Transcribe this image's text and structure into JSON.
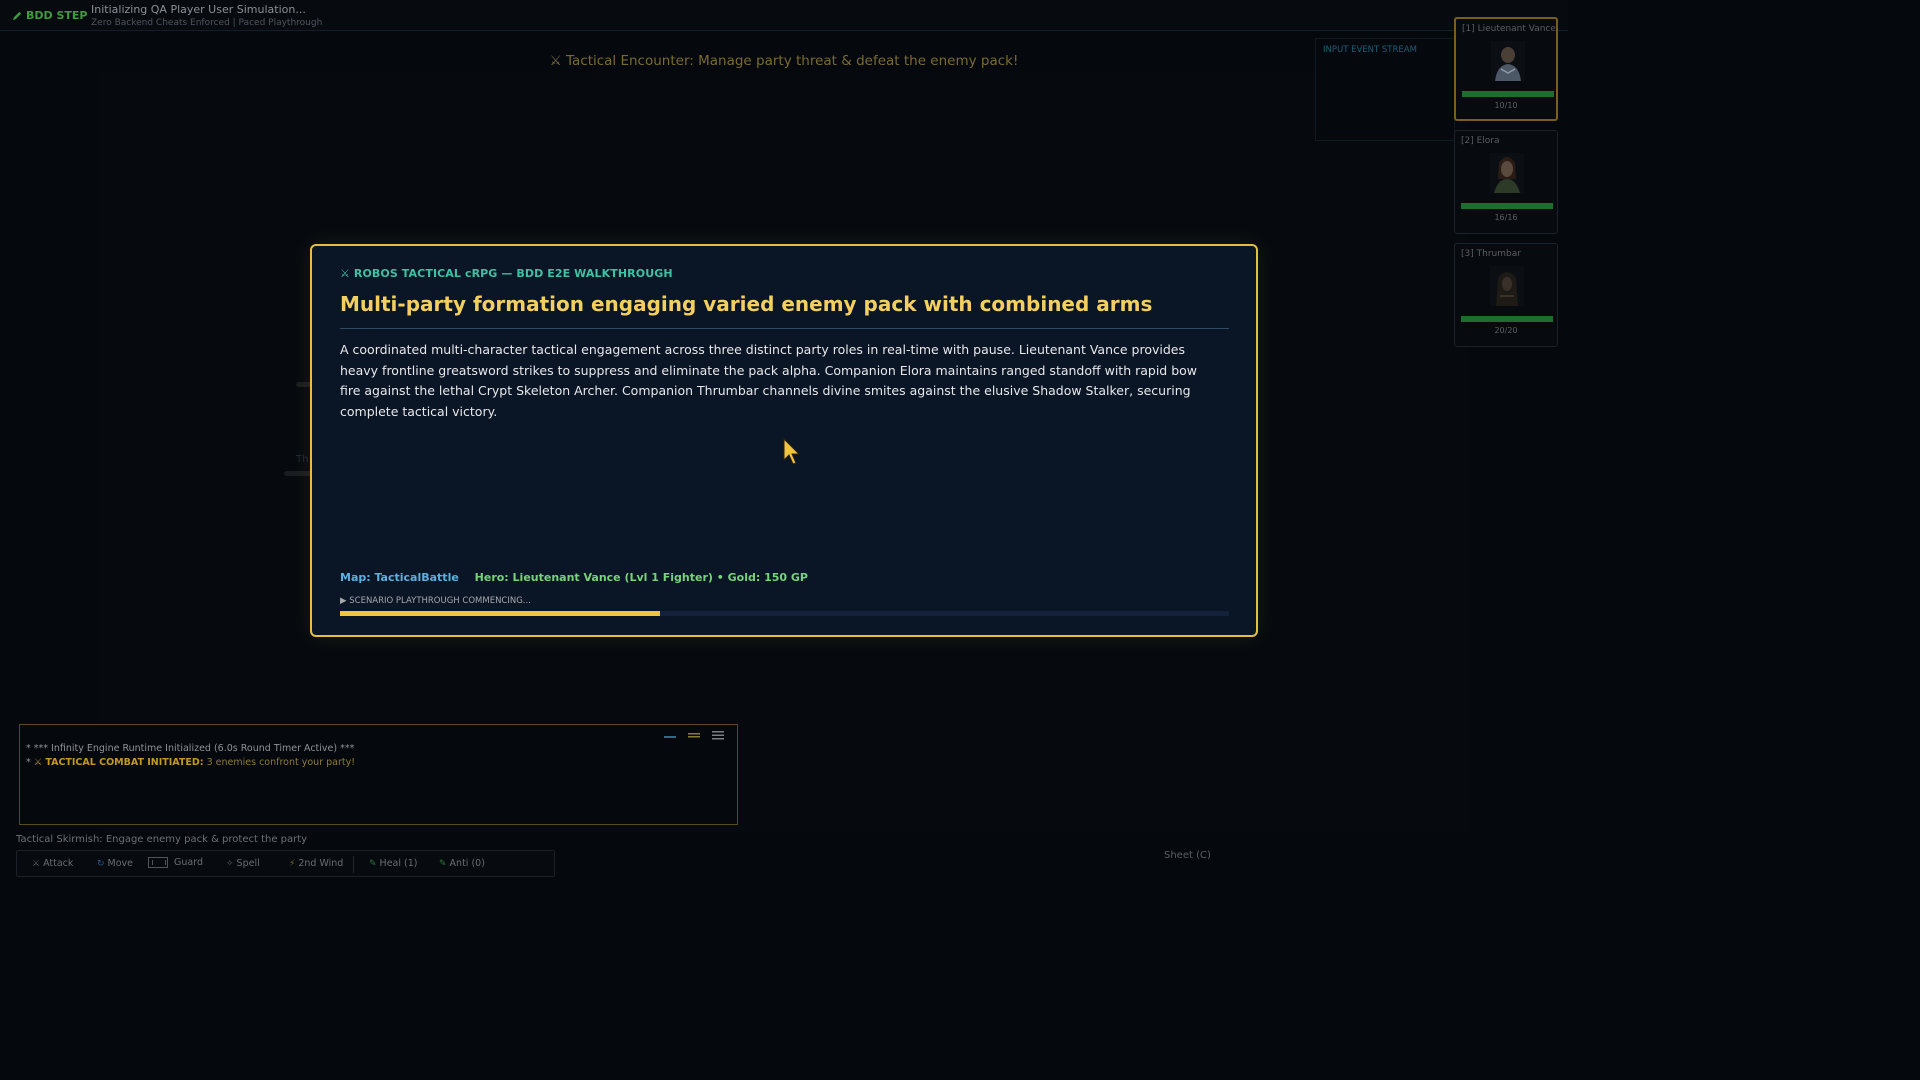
{
  "topbar": {
    "step_label": "BDD STEP",
    "title": "Initializing QA Player User Simulation...",
    "subtitle": "Zero Backend Cheats Enforced | Paced Playthrough"
  },
  "encounter": {
    "title": "⚔ Tactical Encounter: Manage party threat & defeat the enemy pack!",
    "ghost_text": "Th"
  },
  "event_stream": {
    "label": "INPUT EVENT STREAM"
  },
  "party": [
    {
      "key": "[1]",
      "name": "Lieutenant Vance",
      "hp": "10/10",
      "hp_fraction": 1.0,
      "active": true
    },
    {
      "key": "[2]",
      "name": "Elora",
      "hp": "16/16",
      "hp_fraction": 1.0,
      "active": false
    },
    {
      "key": "[3]",
      "name": "Thrumbar",
      "hp": "20/20",
      "hp_fraction": 1.0,
      "active": false
    }
  ],
  "modal": {
    "kicker": "⚔ ROBOS TACTICAL cRPG — BDD E2E WALKTHROUGH",
    "title": "Multi-party formation engaging varied enemy pack with combined arms",
    "description": "A coordinated multi-character tactical engagement across three distinct party roles in real-time with pause. Lieutenant Vance provides heavy frontline greatsword strikes to suppress and eliminate the pack alpha. Companion Elora maintains ranged standoff with rapid bow fire against the lethal Crypt Skeleton Archer. Companion Thrumbar channels divine smites against the elusive Shadow Stalker, securing complete tactical victory.",
    "map": "Map: TacticalBattle",
    "hero": "Hero: Lieutenant Vance (Lvl 1 Fighter) • Gold: 150 GP",
    "status": "▶ SCENARIO PLAYTHROUGH COMMENCING...",
    "progress": 0.36
  },
  "combat_log": {
    "line1": "* *** Infinity Engine Runtime Initialized (6.0s Round Timer Active) ***",
    "line2_prefix": "* ",
    "line2_sword": "⚔",
    "line2_bold": "TACTICAL COMBAT INITIATED:",
    "line2_rest": " 3 enemies confront your party!"
  },
  "skirmish_label": "Tactical Skirmish: Engage enemy pack & protect the party",
  "actions": {
    "attack": "Attack",
    "move": "Move",
    "guard": "Guard",
    "spell": "Spell",
    "second_wind": "2nd Wind",
    "heal": "Heal (1)",
    "anti": "Anti (0)"
  },
  "sheet_label": "Sheet (C)",
  "colors": {
    "accent_gold": "#e6be3f",
    "kicker_teal": "#3fc1a3",
    "hp_green": "#1c6e2e"
  }
}
